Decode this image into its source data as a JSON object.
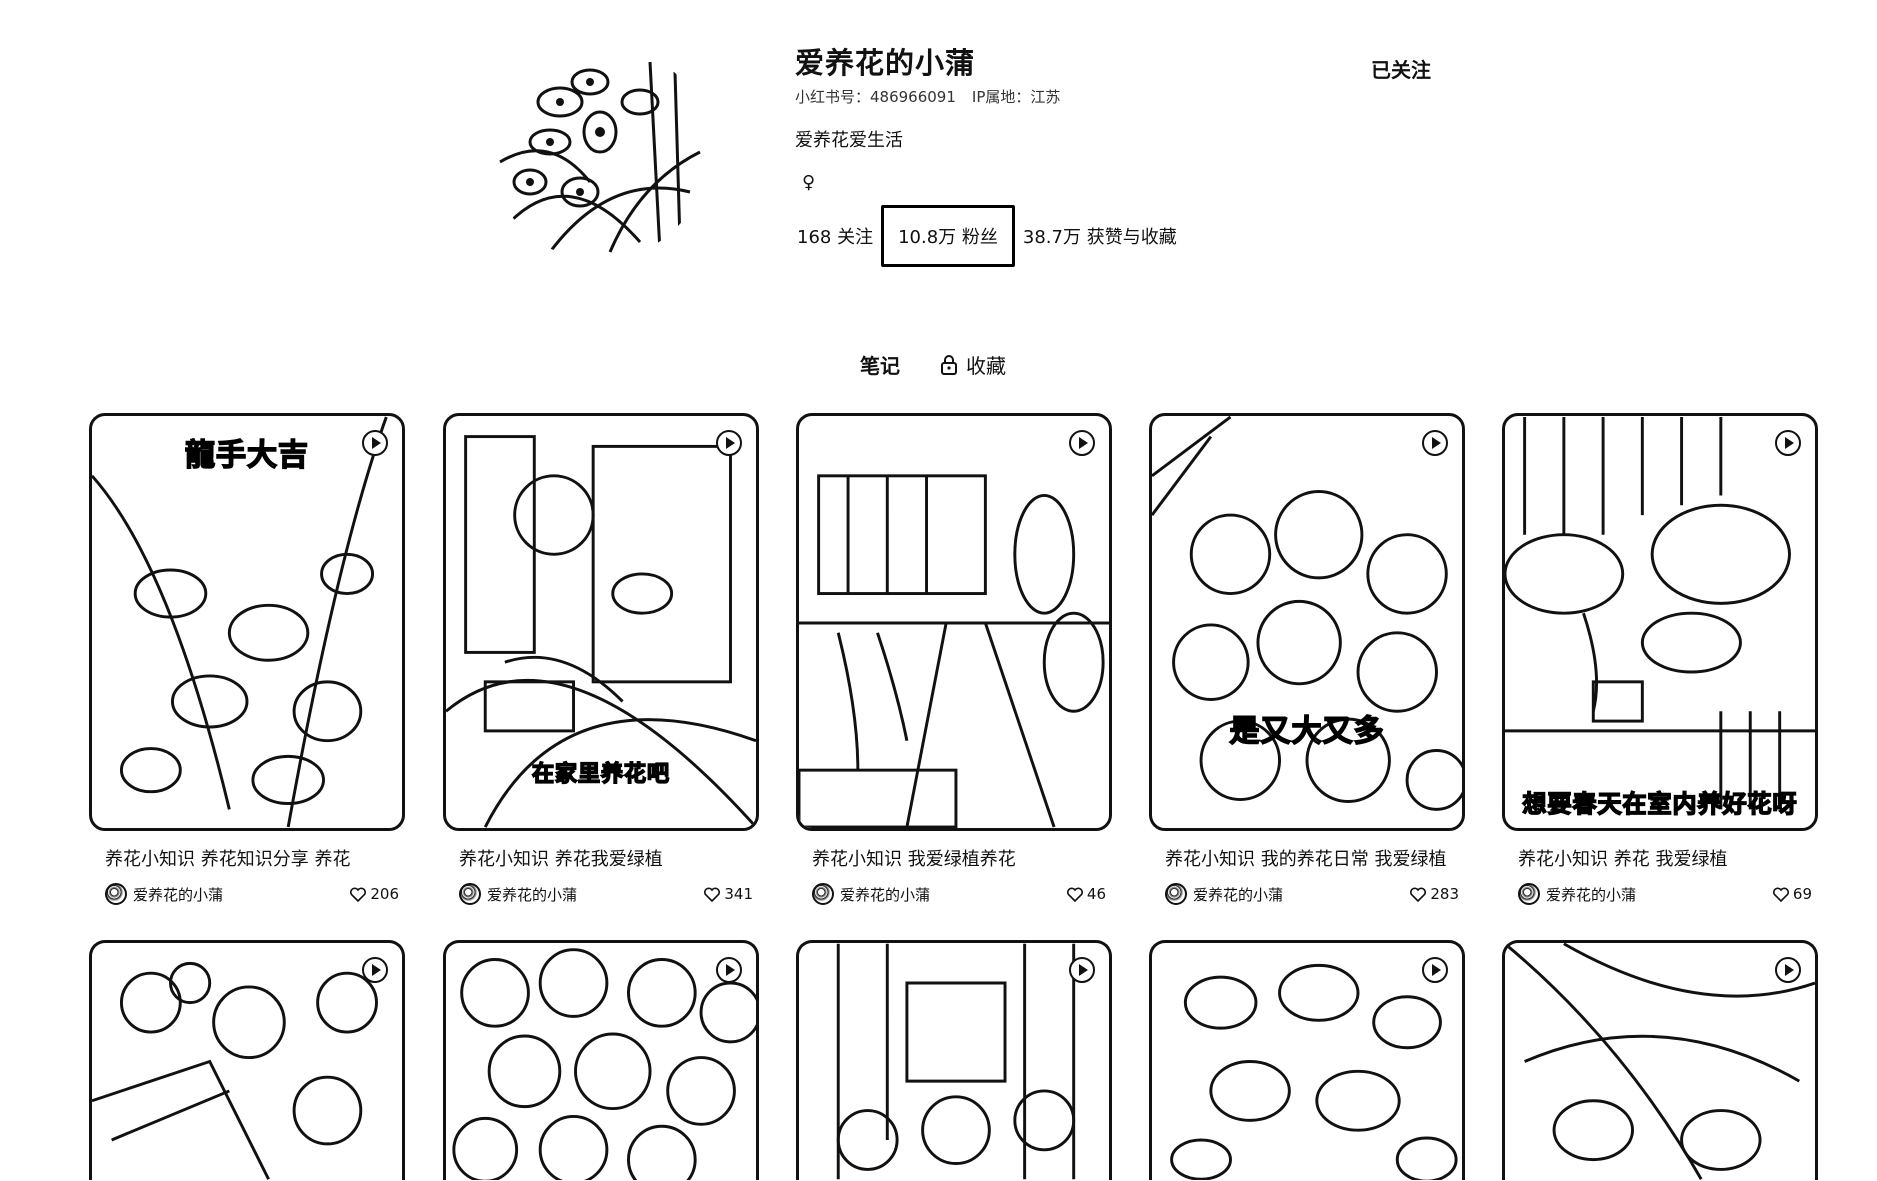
{
  "profile": {
    "name": "爱养花的小蒲",
    "red_id": "小红书号：486966091",
    "ip": "IP属地：江苏",
    "bio": "爱养花爱生活",
    "gender_symbol": "♀",
    "follow_button": "已关注",
    "stats": {
      "following": "168 关注",
      "followers": "10.8万 粉丝",
      "likes_collects": "38.7万 获赞与收藏"
    }
  },
  "tabs": {
    "notes": "笔记",
    "collections": "收藏",
    "collections_icon": "lock-icon"
  },
  "notes": [
    {
      "title": "养花小知识 养花知识分享 养花",
      "author": "爱养花的小蒲",
      "likes": "206",
      "overlay": "龍手大吉"
    },
    {
      "title": "养花小知识 养花我爱绿植",
      "author": "爱养花的小蒲",
      "likes": "341",
      "overlay": "在家里养花吧"
    },
    {
      "title": "养花小知识 我爱绿植养花",
      "author": "爱养花的小蒲",
      "likes": "46",
      "overlay": ""
    },
    {
      "title": "养花小知识 我的养花日常 我爱绿植",
      "author": "爱养花的小蒲",
      "likes": "283",
      "overlay": "是又大又多"
    },
    {
      "title": "养花小知识 养花 我爱绿植",
      "author": "爱养花的小蒲",
      "likes": "69",
      "overlay": "想要春天在室内养好花呀"
    }
  ]
}
